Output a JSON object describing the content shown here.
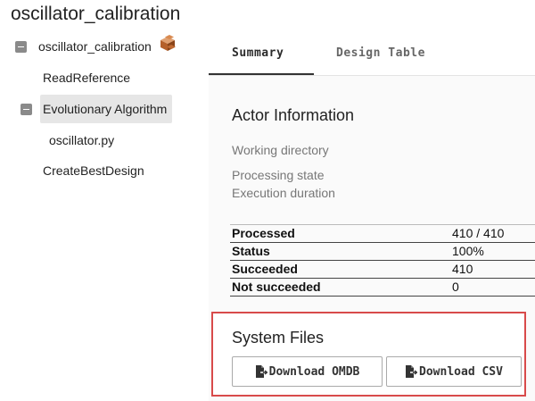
{
  "app": {
    "title": "oscillator_calibration"
  },
  "tree": {
    "root": {
      "label": "oscillator_calibration",
      "icon": "orange-cube-actor-icon"
    },
    "items": [
      {
        "label": "ReadReference"
      },
      {
        "label": "Evolutionary Algorithm",
        "selected": true
      },
      {
        "label": "oscillator.py"
      },
      {
        "label": "CreateBestDesign"
      }
    ]
  },
  "tabs": [
    {
      "label": "Summary",
      "active": true
    },
    {
      "label": "Design Table",
      "active": false
    }
  ],
  "actor_info": {
    "heading": "Actor Information",
    "labels": [
      "Working directory",
      "Processing state",
      "Execution duration"
    ]
  },
  "stats": [
    {
      "name": "Processed",
      "value": "410 / 410"
    },
    {
      "name": "Status",
      "value": "100%"
    },
    {
      "name": "Succeeded",
      "value": "410"
    },
    {
      "name": "Not succeeded",
      "value": "0"
    }
  ],
  "system_files": {
    "heading": "System Files",
    "download_omdb": "Download OMDB",
    "download_csv": "Download CSV"
  },
  "colors": {
    "highlight_border": "#d84a4a",
    "toggle": "#8a8a8a",
    "selected_bg": "#e6e6e6"
  }
}
